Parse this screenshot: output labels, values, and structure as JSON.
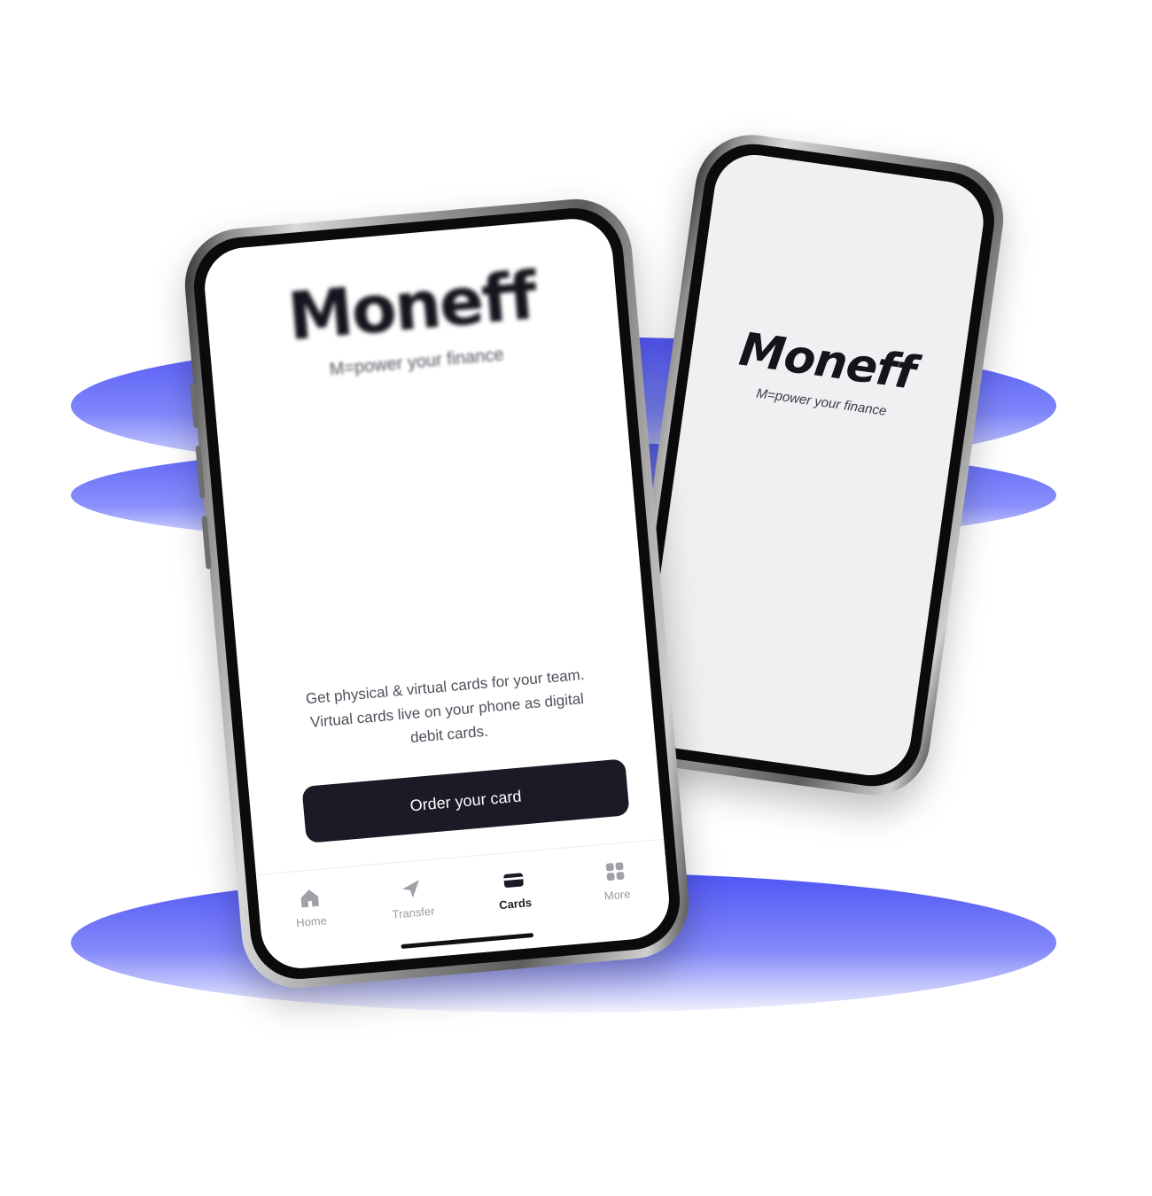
{
  "brand": {
    "name": "Moneff",
    "tagline": "M=power your finance"
  },
  "cards_screen": {
    "description_lines": [
      "Get physical & virtual cards for your team.",
      "Virtual cards live on your phone as digital",
      "debit cards."
    ],
    "order_button_label": "Order your card"
  },
  "tabbar": {
    "items": [
      {
        "label": "Home",
        "icon": "home-icon",
        "active": false
      },
      {
        "label": "Transfer",
        "icon": "send-icon",
        "active": false
      },
      {
        "label": "Cards",
        "icon": "card-icon",
        "active": true
      },
      {
        "label": "More",
        "icon": "grid-icon",
        "active": false
      }
    ]
  },
  "colors": {
    "accent_ellipse": "#5055f5",
    "button_bg": "#1b1b27",
    "splash_bg": "#f0eff1",
    "active_tab": "#1b1b27",
    "inactive_tab": "#9a9aa3"
  }
}
